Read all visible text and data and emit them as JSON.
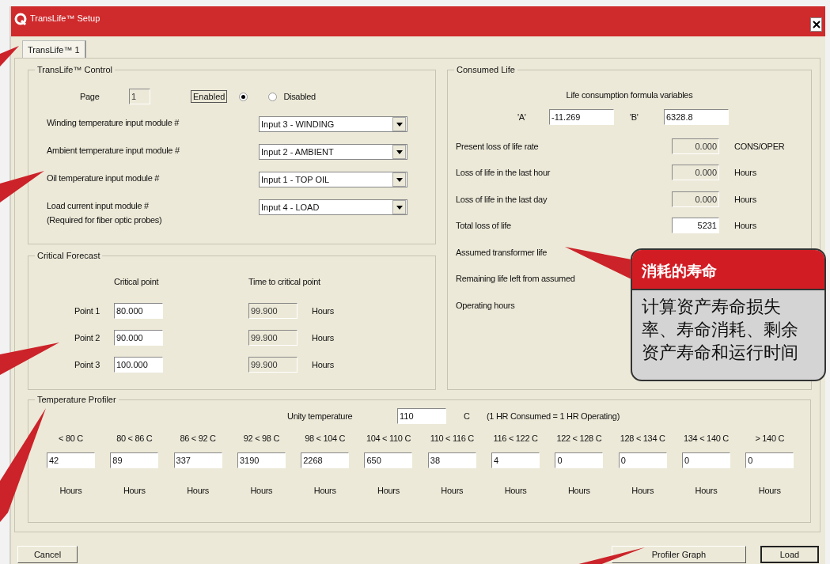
{
  "window": {
    "title": "TransLife™ Setup"
  },
  "tabs": [
    {
      "label": "TransLife™ 1",
      "selected": true
    }
  ],
  "control": {
    "title": "TransLife™ Control",
    "page_label": "Page",
    "page_value": "1",
    "radios": [
      {
        "label": "Enabled",
        "selected": true,
        "kind": "boxed"
      },
      {
        "label": "Disabled",
        "selected": false,
        "kind": "plain"
      }
    ],
    "modules": [
      {
        "label": "Winding temperature input module #",
        "value": "Input 3 - WINDING"
      },
      {
        "label": "Ambient temperature input module #",
        "value": "Input 2 - AMBIENT"
      },
      {
        "label": "Oil temperature input module #",
        "value": "Input 1 - TOP OIL"
      },
      {
        "label": "Load current input module #",
        "note": "(Required for fiber optic probes)",
        "value": "Input 4 - LOAD"
      }
    ]
  },
  "forecast": {
    "title": "Critical Forecast",
    "columns": [
      "Critical point",
      "Time to critical point"
    ],
    "points": [
      {
        "label": "Point 1",
        "critical": "80.000",
        "time": "99.900",
        "unit": "Hours"
      },
      {
        "label": "Point 2",
        "critical": "90.000",
        "time": "99.900",
        "unit": "Hours"
      },
      {
        "label": "Point 3",
        "critical": "100.000",
        "time": "99.900",
        "unit": "Hours"
      }
    ]
  },
  "consumed": {
    "title": "Consumed Life",
    "subtitle": "Life consumption formula variables",
    "a_label": "'A'",
    "a_value": "-11.269",
    "b_label": "'B'",
    "b_value": "6328.8",
    "rows": [
      {
        "label": "Present loss of life rate",
        "value": "0.000",
        "readonly": true,
        "unit": "CONS/OPER"
      },
      {
        "label": "Loss of life in the last hour",
        "value": "0.000",
        "readonly": true,
        "unit": "Hours"
      },
      {
        "label": "Loss of life in the last day",
        "value": "0.000",
        "readonly": true,
        "unit": "Hours"
      },
      {
        "label": "Total loss of life",
        "value": "5231",
        "readonly": false,
        "unit": "Hours"
      },
      {
        "label": "Assumed transformer life"
      },
      {
        "label": "Remaining life left from assumed"
      },
      {
        "label": "Operating hours"
      }
    ]
  },
  "callout": {
    "title": "消耗的寿命",
    "body": "计算资产寿命损失率、寿命消耗、剩余资产寿命和运行时间"
  },
  "profiler": {
    "title": "Temperature Profiler",
    "unity_label": "Unity temperature",
    "unity_value": "110",
    "unity_unit": "C",
    "note": "(1 HR Consumed = 1 HR Operating)",
    "bins": [
      {
        "range": "< 80 C",
        "value": "42",
        "unit": "Hours"
      },
      {
        "range": "80 < 86 C",
        "value": "89",
        "unit": "Hours"
      },
      {
        "range": "86 < 92 C",
        "value": "337",
        "unit": "Hours"
      },
      {
        "range": "92 < 98 C",
        "value": "3190",
        "unit": "Hours"
      },
      {
        "range": "98 < 104 C",
        "value": "2268",
        "unit": "Hours"
      },
      {
        "range": "104 < 110 C",
        "value": "650",
        "unit": "Hours"
      },
      {
        "range": "110 < 116 C",
        "value": "38",
        "unit": "Hours"
      },
      {
        "range": "116 < 122 C",
        "value": "4",
        "unit": "Hours"
      },
      {
        "range": "122 < 128 C",
        "value": "0",
        "unit": "Hours"
      },
      {
        "range": "128 < 134 C",
        "value": "0",
        "unit": "Hours"
      },
      {
        "range": "134 < 140 C",
        "value": "0",
        "unit": "Hours"
      },
      {
        "range": "> 140 C",
        "value": "0",
        "unit": "Hours"
      }
    ]
  },
  "buttons": [
    {
      "label": "Cancel",
      "kind": "normal"
    },
    {
      "label": "Profiler Graph",
      "kind": "wide"
    },
    {
      "label": "Load",
      "kind": "default"
    }
  ]
}
